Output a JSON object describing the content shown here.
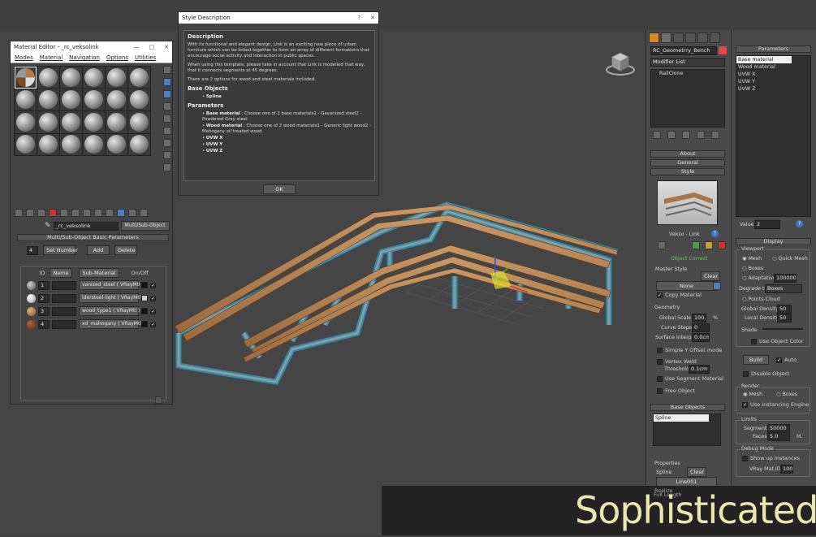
{
  "material_editor": {
    "title": "Material Editor - _rc_veksolink",
    "menus": [
      "Modes",
      "Material",
      "Navigation",
      "Options",
      "Utilities"
    ],
    "material_name": "_rc_veksolink",
    "material_type": "Multi/Sub-Object",
    "rollout": "Multi/Sub-Object Basic Parameters",
    "count": "4",
    "set_number": "Set Number",
    "add": "Add",
    "delete": "Delete",
    "headers": {
      "id": "ID",
      "name": "Name",
      "sub": "Sub-Material",
      "onoff": "On/Off"
    },
    "rows": [
      {
        "id": "1",
        "sub": "vanized_steel ( VRayMtl )",
        "color": "#8d8d8d"
      },
      {
        "id": "2",
        "sub": "idersteel-light ( VRayMtl )",
        "color": "#cfcfcf"
      },
      {
        "id": "3",
        "sub": "wood_type1 ( VRayMtl )",
        "color": "#c9955e"
      },
      {
        "id": "4",
        "sub": "xd_mahogany ( VRayMtl )",
        "color": "#8a4a22"
      }
    ]
  },
  "dialog": {
    "title": "Style Description",
    "h_description": "Description",
    "p1": "With its functional and elegant design, Link is an exciting new piece of urban furniture which can be linked together to form an array of different formations that encourage social activity and interaction in public spaces.",
    "p2": "When using this template, please take in account that Link is modelled that way, that it connects segments at 45 degrees.",
    "p3": "There are 2 options for wood and steel materials included.",
    "h_base": "Base Objects",
    "base_item": "Spline",
    "h_params": "Parameters",
    "param1_name": "Base material",
    "param1_text": " : Choose one of 2 base materials1 - Gavanized steel2 - Powdered Grey steel",
    "param2_name": "Wood material",
    "param2_text": " : Choose one of 2 wood materials1 - Generic light wood2 - Mahogany oil treated wood",
    "uvw": [
      "UVW X",
      "UVW Y",
      "UVW Z"
    ],
    "ok": "OK"
  },
  "command_panel": {
    "object_name": "RC_Geometrry_Bench",
    "modifier_list": "Modifier List",
    "stack_item": "RailClone",
    "about": "About",
    "general": "General",
    "style": "Style",
    "style_name": "Vekso - Link",
    "status": "Object Correct",
    "master_style": "Master Style",
    "clear": "Clear",
    "none": "None",
    "copy_material": "Copy Material",
    "geometry": "Geometry",
    "global_scale_label": "Global Scale",
    "global_scale": "100.0",
    "curve_steps_label": "Curve Steps",
    "curve_steps": "0",
    "surface_interp_label": "Surface Interp.",
    "surface_interp": "0.0cm",
    "simple_y": "Simple Y Offset mode",
    "vertex_weld": "Vertex Weld",
    "threshold_label": "Threshold",
    "threshold": "0.1cm",
    "use_segment": "Use Segment Material",
    "free_object": "Free Object",
    "base_objects": "Base Objects",
    "base_item": "Spline",
    "properties": "Properties",
    "prop_spline": "Spline",
    "prop_clear": "Clear",
    "prop_line": "Line001",
    "realize": "Realize",
    "full_length": "Full Length"
  },
  "params_panel": {
    "title": "Parameters",
    "items": [
      "Base material",
      "Wood material",
      "UVW X",
      "UVW Y",
      "UVW Z"
    ],
    "value_label": "Value",
    "value": "2",
    "display": "Display",
    "viewport": "Viewport",
    "mesh": "Mesh",
    "quick_mesh": "Quick Mesh",
    "boxes": "Boxes",
    "adaptative": "Adaptative",
    "adaptative_val": "100000",
    "degrade_label": "Degrade to",
    "degrade_val": "Boxes",
    "points_cloud": "Points-Cloud",
    "global_density_label": "Global Density",
    "global_density": "50",
    "local_density_label": "Local Density",
    "local_density": "50",
    "shade": "Shade",
    "use_object_color": "Use Object Color",
    "build": "Build",
    "auto": "Auto",
    "disable_object": "Disable Object",
    "render": "Render",
    "r_mesh": "Mesh",
    "r_boxes": "Boxes",
    "instancing": "Use Instancing Engine",
    "limits": "Limits",
    "segments_label": "Segments",
    "segments": "50000",
    "faces_label": "Faces",
    "faces": "5.0",
    "faces_unit": "M.",
    "debug": "Debug Mode",
    "show_instances": "Show up Instances",
    "vray_label": "VRay Mat.ID",
    "vray_val": "100"
  },
  "banner": {
    "text": "Sophisticated"
  }
}
